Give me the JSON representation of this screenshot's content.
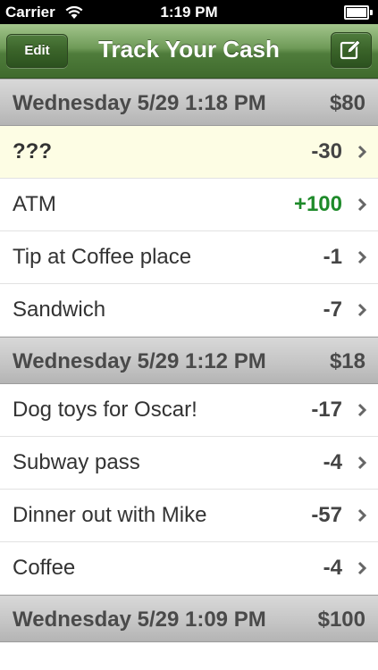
{
  "status_bar": {
    "carrier": "Carrier",
    "time": "1:19 PM"
  },
  "nav_bar": {
    "title": "Track Your Cash",
    "edit_label": "Edit"
  },
  "sections": [
    {
      "header": "Wednesday 5/29 1:18 PM",
      "total": "$80",
      "rows": [
        {
          "label": "???",
          "amount": "-30"
        },
        {
          "label": "ATM",
          "amount": "+100"
        },
        {
          "label": "Tip at Coffee place",
          "amount": "-1"
        },
        {
          "label": "Sandwich",
          "amount": "-7"
        }
      ]
    },
    {
      "header": "Wednesday 5/29 1:12 PM",
      "total": "$18",
      "rows": [
        {
          "label": "Dog toys for Oscar!",
          "amount": "-17"
        },
        {
          "label": "Subway pass",
          "amount": "-4"
        },
        {
          "label": "Dinner out with Mike",
          "amount": "-57"
        },
        {
          "label": "Coffee",
          "amount": "-4"
        }
      ]
    },
    {
      "header": "Wednesday 5/29 1:09 PM",
      "total": "$100",
      "rows": []
    }
  ],
  "colors": {
    "positive": "#1e8a2a",
    "nav_green": "#4f7c3b",
    "highlight": "#fdfde4"
  },
  "icons": {
    "compose": "compose-icon",
    "disclosure": "chevron-right-icon",
    "wifi": "wifi-icon",
    "battery": "battery-icon"
  }
}
